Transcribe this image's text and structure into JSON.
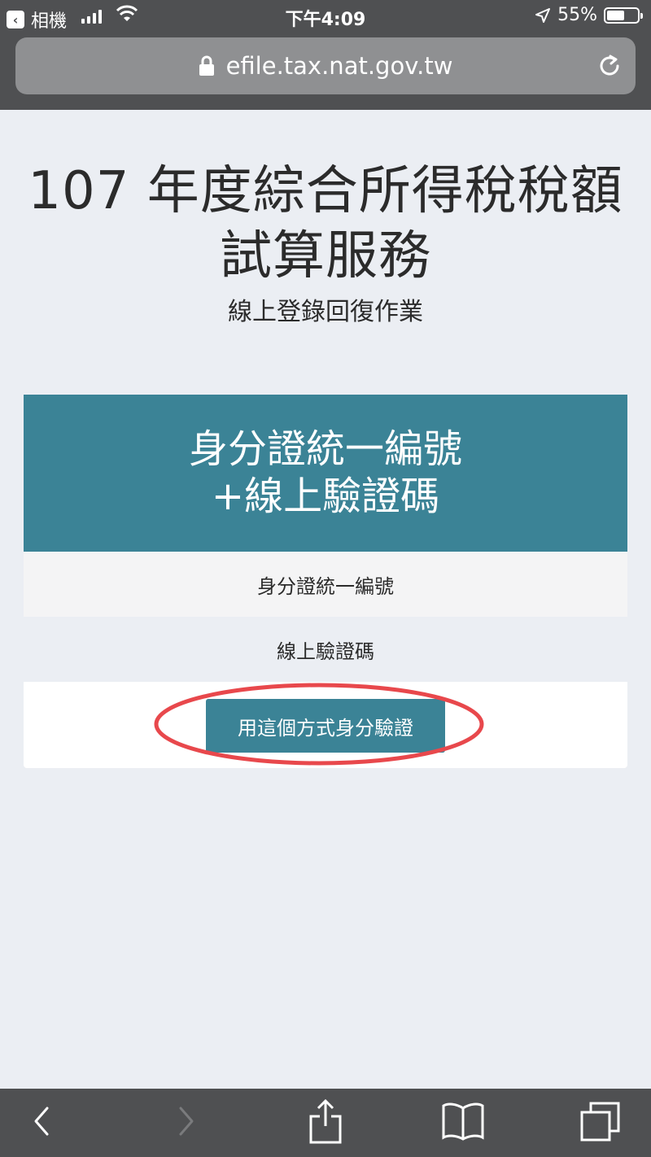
{
  "status_bar": {
    "back_app": "相機",
    "time": "下午4:09",
    "battery": "55%"
  },
  "browser": {
    "url": "efile.tax.nat.gov.tw"
  },
  "page": {
    "title_line1": "107 年度綜合所得稅稅額",
    "title_line2": "試算服務",
    "subtitle": "線上登錄回復作業"
  },
  "card": {
    "header_line1": "身分證統一編號",
    "header_line2": "+線上驗證碼",
    "field1_label": "身分證統一編號",
    "field2_label": "線上驗證碼",
    "button_label": "用這個方式身分驗證"
  },
  "colors": {
    "accent": "#3b8396",
    "highlight": "#e8484c"
  }
}
